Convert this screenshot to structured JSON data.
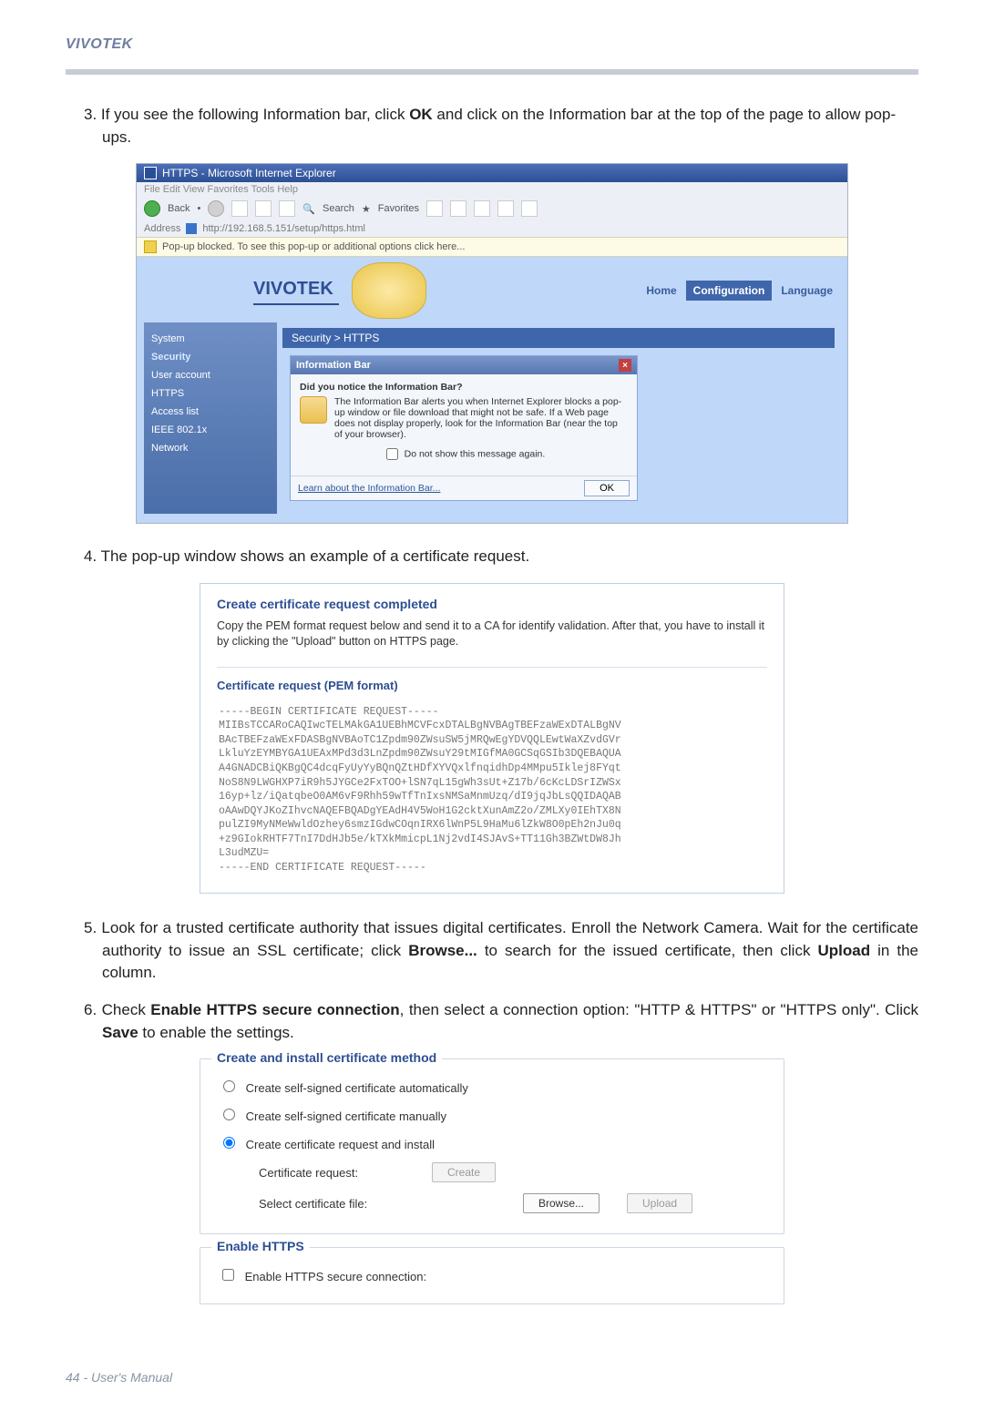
{
  "brand": "VIVOTEK",
  "steps": {
    "s3_a": "3. If you see the following Information bar, click ",
    "s3_b": "OK",
    "s3_c": " and click on the Information bar at the top of the page to allow pop-ups.",
    "s4": "4. The pop-up window shows an example of a certificate request.",
    "s5_a": "5. Look for a trusted certificate authority that issues digital certificates. Enroll the Network Camera. Wait for the certificate authority to issue an SSL certificate; click ",
    "s5_b": "Browse...",
    "s5_c": " to search for the issued certificate, then click ",
    "s5_d": "Upload",
    "s5_e": " in the column.",
    "s6_a": "6. Check ",
    "s6_b": "Enable HTTPS secure connection",
    "s6_c": ", then select a connection option: \"HTTP & HTTPS\" or \"HTTPS only\". Click ",
    "s6_d": "Save",
    "s6_e": " to enable the settings."
  },
  "ie": {
    "title": "HTTPS - Microsoft Internet Explorer",
    "menu": "File   Edit   View   Favorites   Tools   Help",
    "back": "Back",
    "search": "Search",
    "favorites": "Favorites",
    "addr_label": "Address",
    "addr": "http://192.168.5.151/setup/https.html",
    "infobar": "Pop-up blocked. To see this pop-up or additional options click here..."
  },
  "app": {
    "logo": "VIVOTEK",
    "home": "Home",
    "config": "Configuration",
    "language": "Language",
    "tabs": "Security  >  HTTPS",
    "side": [
      "System",
      "Security",
      "User account",
      "HTTPS",
      "Access list",
      "IEEE 802.1x",
      "Network"
    ]
  },
  "dlg": {
    "title": "Information Bar",
    "q": "Did you notice the Information Bar?",
    "body": "The Information Bar alerts you when Internet Explorer blocks a pop-up window or file download that might not be safe. If a Web page does not display properly, look for the Information Bar (near the top of your browser).",
    "dontshow": "Do not show this message again.",
    "learn": "Learn about the Information Bar...",
    "ok": "OK"
  },
  "cert": {
    "head": "Create certificate request completed",
    "desc": "Copy the PEM format request below and send it to a CA for identify validation. After that, you have to install it by clicking the \"Upload\" button on HTTPS page.",
    "sub": "Certificate request (PEM format)",
    "pem": "-----BEGIN CERTIFICATE REQUEST-----\nMIIBsTCCARoCAQIwcTELMAkGA1UEBhMCVFcxDTALBgNVBAgTBEFzaWExDTALBgNV\nBAcTBEFzaWExFDASBgNVBAoTC1Zpdm90ZWsuSW5jMRQwEgYDVQQLEwtWaXZvdGVr\nLkluYzEYMBYGA1UEAxMPd3d3LnZpdm90ZWsuY29tMIGfMA0GCSqGSIb3DQEBAQUA\nA4GNADCBiQKBgQC4dcqFyUyYyBQnQZtHDfXYVQxlfnqidhDp4MMpu5Iklej8FYqt\nNoS8N9LWGHXP7iR9h5JYGCe2FxTOO+lSN7qL15gWh3sUt+Z17b/6cKcLDSrIZWSx\n16yp+lz/iQatqbeO0AM6vF9Rhh59wTfTnIxsNMSaMnmUzq/dI9jqJbLsQQIDAQAB\noAAwDQYJKoZIhvcNAQEFBQADgYEAdH4V5WoH1G2cktXunAmZ2o/ZMLXy0IEhTX8N\npulZI9MyNMeWwldOzhey6smzIGdwCOqnIRX6lWnP5L9HaMu6lZkW8O0pEh2nJu0q\n+z9GIokRHTF7TnI7DdHJb5e/kTXkMmicpL1Nj2vdI4SJAvS+TT11Gh3BZWtDW8Jh\nL3udMZU=\n-----END CERTIFICATE REQUEST-----"
  },
  "ci": {
    "title": "Create and install certificate method",
    "r1": "Create self-signed certificate automatically",
    "r2": "Create self-signed certificate manually",
    "r3": "Create certificate request and install",
    "cert_request": "Certificate request:",
    "create_btn": "Create",
    "select_file": "Select certificate file:",
    "browse_btn": "Browse...",
    "upload_btn": "Upload"
  },
  "eh": {
    "title": "Enable HTTPS",
    "label": "Enable HTTPS secure connection:"
  },
  "footer": "44 - User's Manual"
}
